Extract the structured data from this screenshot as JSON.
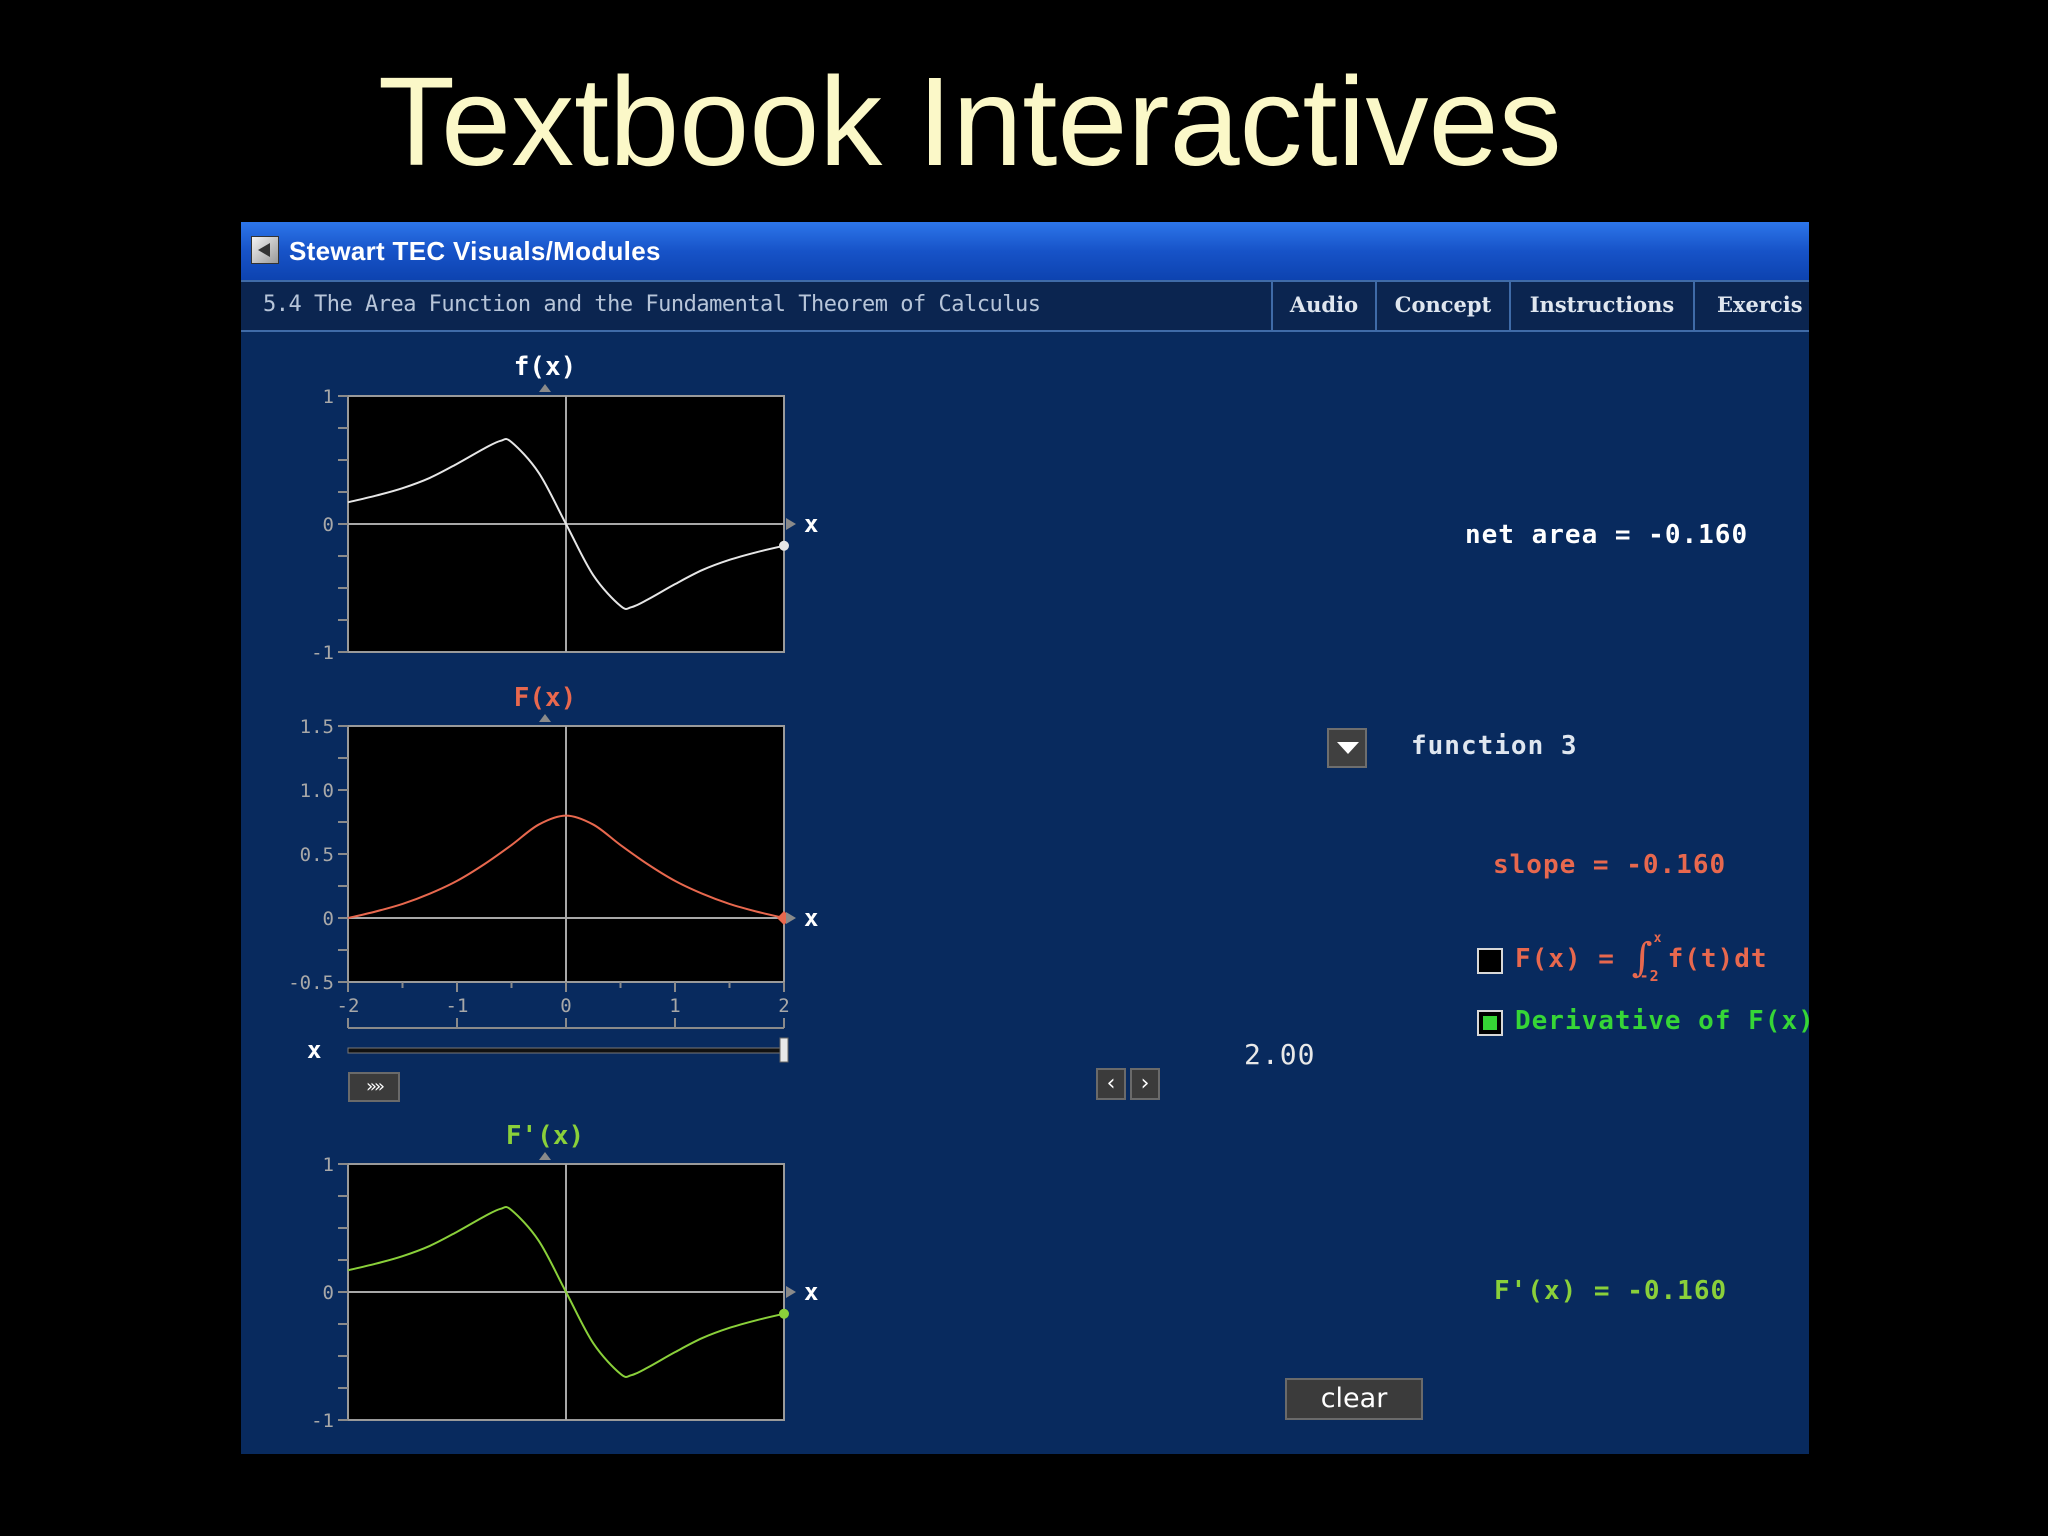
{
  "slide": {
    "title": "Textbook Interactives"
  },
  "window": {
    "title": "Stewart TEC Visuals/Modules",
    "icon": "app-icon"
  },
  "menubar": {
    "section": "5.4 The Area Function and the Fundamental Theorem of Calculus",
    "tabs": [
      {
        "label": "Audio"
      },
      {
        "label": "Concept"
      },
      {
        "label": "Instructions"
      },
      {
        "label": "Exercis"
      }
    ]
  },
  "colors": {
    "f": "#e6e6e6",
    "F": "#e8684e",
    "dF": "#8ad03a",
    "panel": "#082a5e",
    "titlebar": "#1f5fd6",
    "accent_green": "#36d636"
  },
  "readouts": {
    "net_area": "net area = -0.160",
    "function_select": "function 3",
    "slope": "slope = -0.160",
    "derivative_value": "F'(x) = -0.160"
  },
  "legend": {
    "integral": {
      "prefix": "F(x) =",
      "lower": "-2",
      "upper": "x",
      "integrand": "f(t)dt",
      "checked": false
    },
    "derivative": {
      "label": "Derivative of F(x)",
      "checked": true
    }
  },
  "slider": {
    "label": "x",
    "value_text": "2.00",
    "value": 2.0,
    "min": -2,
    "max": 2
  },
  "buttons": {
    "clear": "clear",
    "play": "»»",
    "step_back": "‹",
    "step_forward": "›"
  },
  "chart_data": [
    {
      "type": "line",
      "title": "f(x)",
      "xlabel": "x",
      "xlim": [
        -2,
        2
      ],
      "ylim": [
        -1,
        1
      ],
      "yticks": [
        {
          "v": 1,
          "label": "1"
        },
        {
          "v": 0,
          "label": "0"
        },
        {
          "v": -1,
          "label": "-1"
        }
      ],
      "series": [
        {
          "x": [
            -2,
            -1.75,
            -1.5,
            -1.25,
            -1,
            -0.75,
            -0.6,
            -0.5,
            -0.25,
            0,
            0.25,
            0.5,
            0.6,
            0.75,
            1,
            1.25,
            1.5,
            1.75,
            2
          ],
          "y": [
            0.17,
            0.22,
            0.28,
            0.36,
            0.47,
            0.59,
            0.65,
            0.64,
            0.4,
            0,
            -0.4,
            -0.64,
            -0.65,
            -0.59,
            -0.47,
            -0.36,
            -0.28,
            -0.22,
            -0.17
          ]
        }
      ],
      "marker": {
        "x": 2,
        "y": -0.17
      }
    },
    {
      "type": "line",
      "title": "F(x)",
      "xlabel": "x",
      "xlim": [
        -2,
        2
      ],
      "ylim": [
        -0.5,
        1.5
      ],
      "yticks": [
        {
          "v": 1.5,
          "label": "1.5"
        },
        {
          "v": 1.0,
          "label": "1.0"
        },
        {
          "v": 0.5,
          "label": "0.5"
        },
        {
          "v": 0,
          "label": "0"
        },
        {
          "v": -0.5,
          "label": "-0.5"
        }
      ],
      "xticks": [
        {
          "v": -2,
          "label": "-2"
        },
        {
          "v": -1,
          "label": "-1"
        },
        {
          "v": 0,
          "label": "0"
        },
        {
          "v": 1,
          "label": "1"
        },
        {
          "v": 2,
          "label": "2"
        }
      ],
      "series": [
        {
          "x": [
            -2,
            -1.75,
            -1.5,
            -1.25,
            -1,
            -0.75,
            -0.5,
            -0.25,
            0,
            0.25,
            0.5,
            0.75,
            1,
            1.25,
            1.5,
            1.75,
            2
          ],
          "y": [
            0.0,
            0.05,
            0.11,
            0.19,
            0.29,
            0.42,
            0.57,
            0.73,
            0.8,
            0.73,
            0.57,
            0.42,
            0.29,
            0.19,
            0.11,
            0.05,
            0.0
          ]
        }
      ],
      "marker": {
        "x": 2,
        "y": 0
      }
    },
    {
      "type": "line",
      "title": "F'(x)",
      "xlabel": "x",
      "xlim": [
        -2,
        2
      ],
      "ylim": [
        -1,
        1
      ],
      "yticks": [
        {
          "v": 1,
          "label": "1"
        },
        {
          "v": 0,
          "label": "0"
        },
        {
          "v": -1,
          "label": "-1"
        }
      ],
      "series": [
        {
          "x": [
            -2,
            -1.75,
            -1.5,
            -1.25,
            -1,
            -0.75,
            -0.6,
            -0.5,
            -0.25,
            0,
            0.25,
            0.5,
            0.6,
            0.75,
            1,
            1.25,
            1.5,
            1.75,
            2
          ],
          "y": [
            0.17,
            0.22,
            0.28,
            0.36,
            0.47,
            0.59,
            0.65,
            0.64,
            0.4,
            0,
            -0.4,
            -0.64,
            -0.65,
            -0.59,
            -0.47,
            -0.36,
            -0.28,
            -0.22,
            -0.17
          ]
        }
      ],
      "marker": {
        "x": 2,
        "y": -0.17
      }
    }
  ]
}
